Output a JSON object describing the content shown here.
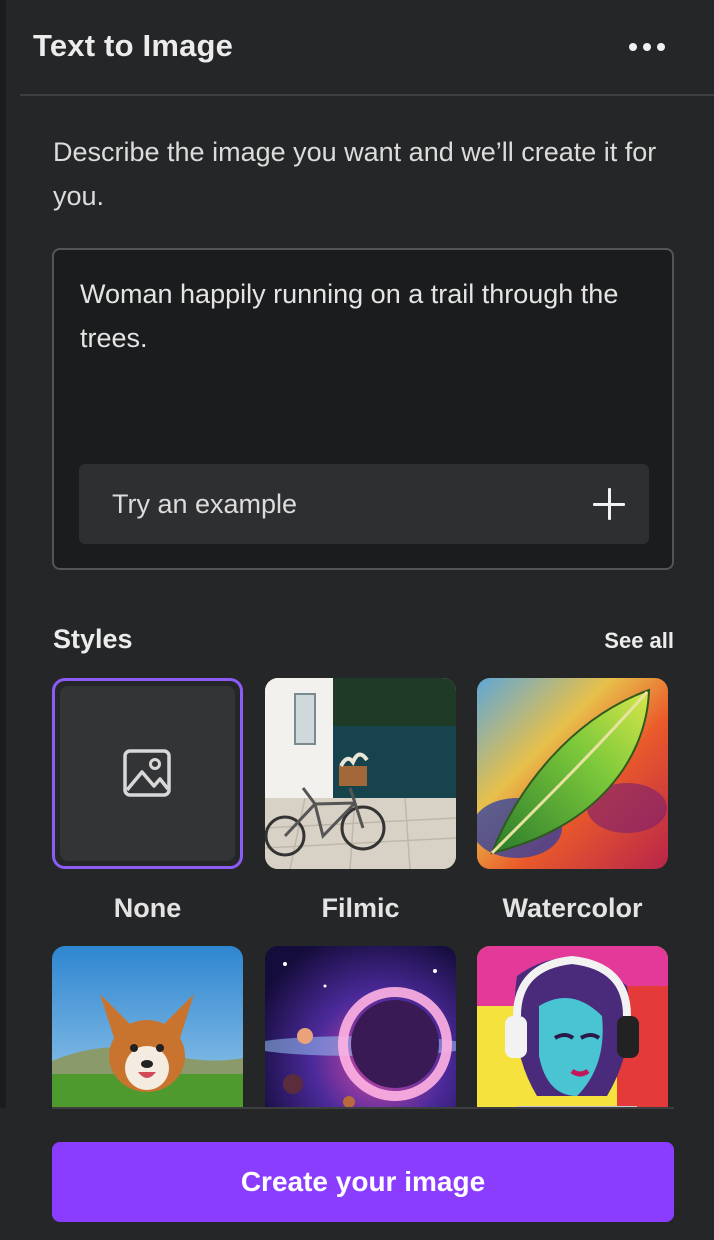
{
  "panel": {
    "title": "Text to Image",
    "more_icon": "more-horizontal-icon",
    "description": "Describe the image you want and we’ll create it for you.",
    "prompt": {
      "value": "Woman happily running on a trail through the trees.",
      "try_example_label": "Try an example",
      "try_example_icon": "plus-icon"
    },
    "styles": {
      "heading": "Styles",
      "see_all_label": "See all",
      "selected": "None",
      "items": [
        {
          "label": "None",
          "icon": "image-icon"
        },
        {
          "label": "Filmic"
        },
        {
          "label": "Watercolor"
        },
        {
          "label": ""
        },
        {
          "label": ""
        },
        {
          "label": ""
        }
      ]
    },
    "create_button_label": "Create your image"
  },
  "colors": {
    "background": "#252627",
    "accent": "#8b3dff",
    "selected_border": "#8b5cf6"
  }
}
